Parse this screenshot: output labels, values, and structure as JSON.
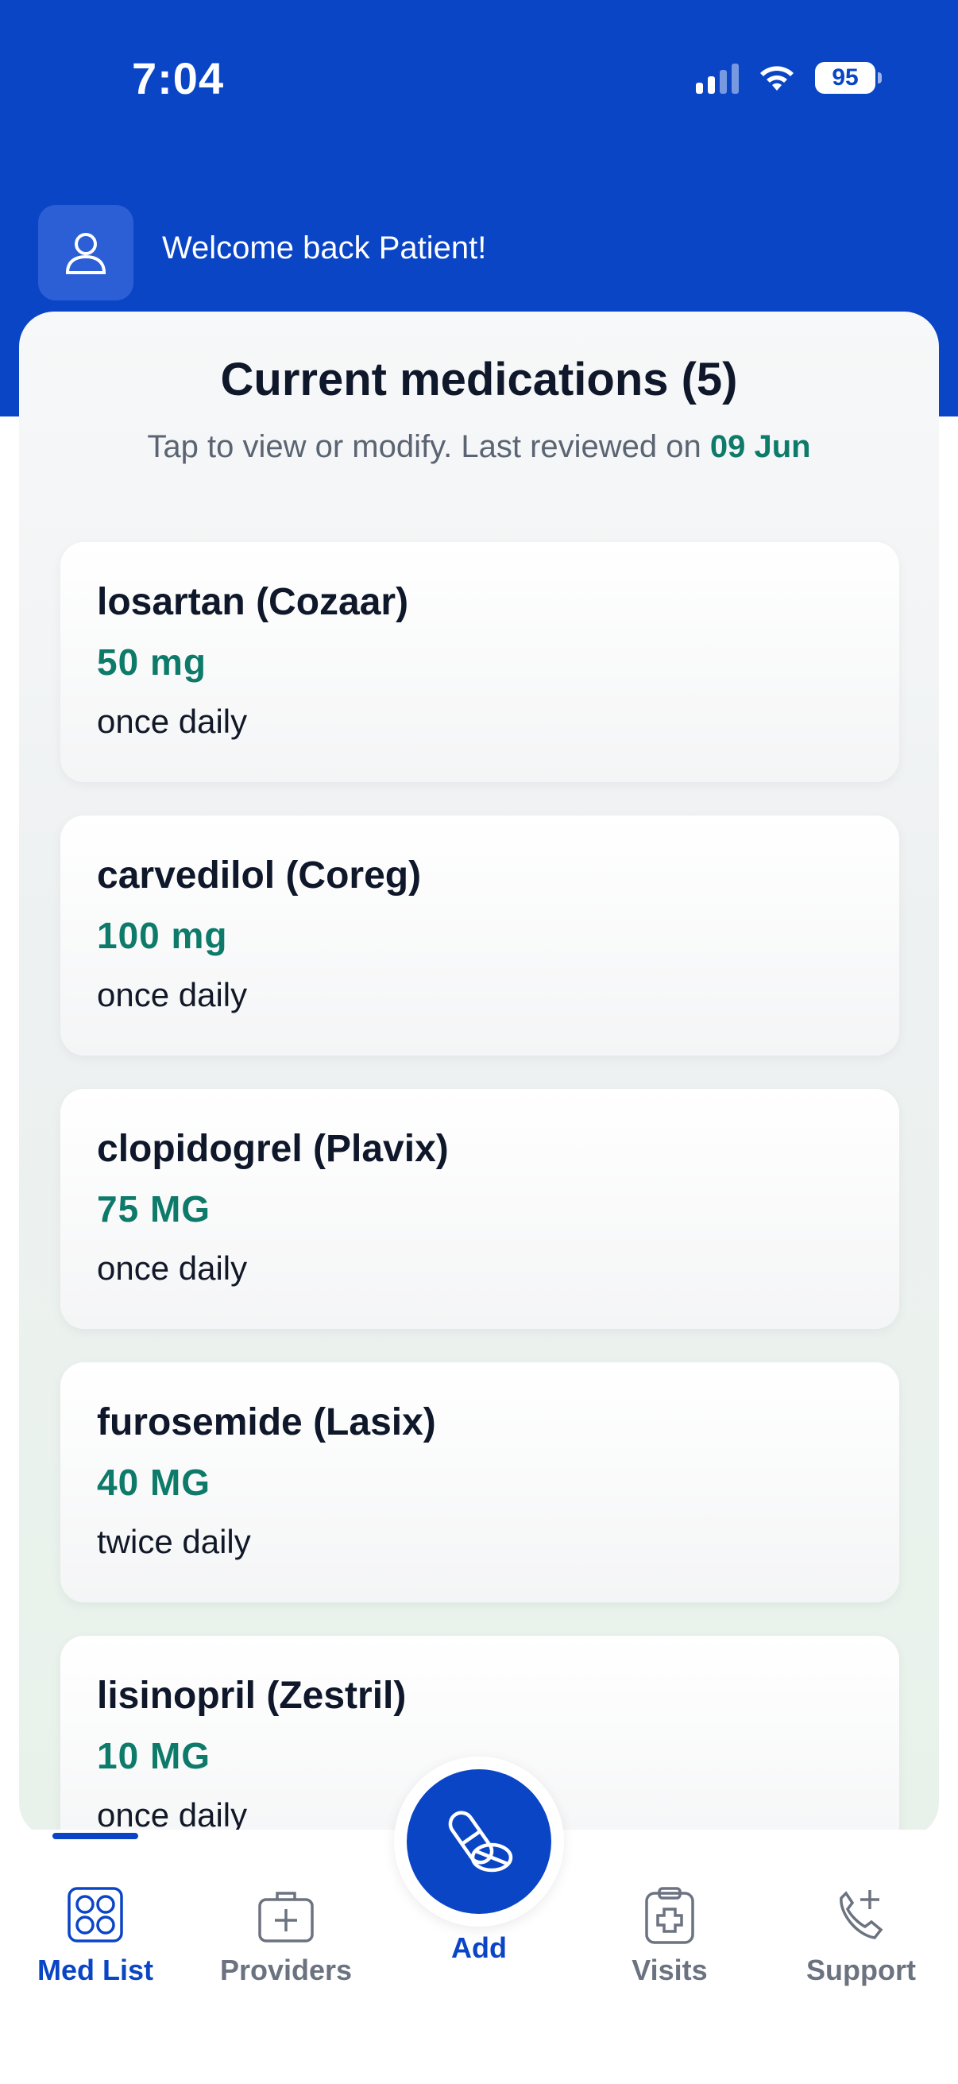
{
  "status_bar": {
    "time": "7:04",
    "battery": "95"
  },
  "header": {
    "welcome_text": "Welcome back Patient!"
  },
  "medications": {
    "title": "Current medications (5)",
    "subtitle_prefix": "Tap to view or modify. Last reviewed on ",
    "last_reviewed": "09 Jun",
    "items": [
      {
        "name": "losartan (Cozaar)",
        "dose": "50 mg",
        "frequency": "once daily"
      },
      {
        "name": "carvedilol (Coreg)",
        "dose": "100 mg",
        "frequency": "once daily"
      },
      {
        "name": "clopidogrel (Plavix)",
        "dose": "75 MG",
        "frequency": "once daily"
      },
      {
        "name": "furosemide (Lasix)",
        "dose": "40 MG",
        "frequency": "twice daily"
      },
      {
        "name": "lisinopril (Zestril)",
        "dose": "10 MG",
        "frequency": "once daily"
      }
    ]
  },
  "nav": {
    "items": [
      {
        "label": "Med List",
        "icon": "pill-organizer-icon",
        "active": true
      },
      {
        "label": "Providers",
        "icon": "medical-bag-icon",
        "active": false
      },
      {
        "label": "Add",
        "icon": "pills-icon",
        "active": false
      },
      {
        "label": "Visits",
        "icon": "clipboard-plus-icon",
        "active": false
      },
      {
        "label": "Support",
        "icon": "phone-plus-icon",
        "active": false
      }
    ]
  },
  "colors": {
    "brand_blue": "#0a45c6",
    "accent_green": "#0d7a6a",
    "muted_text": "#5b6472"
  }
}
